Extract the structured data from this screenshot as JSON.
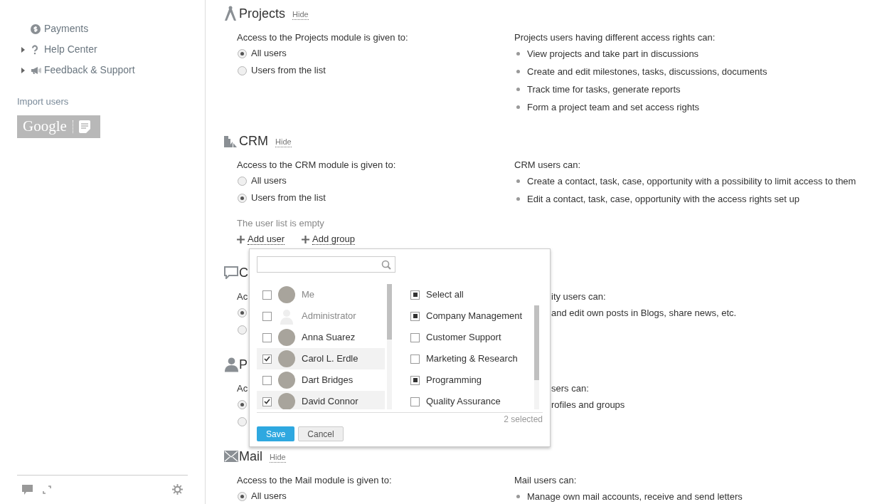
{
  "sidebar": {
    "items": [
      {
        "label": "Payments",
        "expandable": false
      },
      {
        "label": "Help Center",
        "expandable": true
      },
      {
        "label": "Feedback & Support",
        "expandable": true
      }
    ],
    "import_label": "Import users",
    "import_button": "Google"
  },
  "sections": [
    {
      "kind": "full",
      "title": "Projects",
      "hide": "Hide",
      "access_label": "Access to the Projects module is given to:",
      "options": [
        {
          "label": "All users",
          "selected": true
        },
        {
          "label": "Users from the list",
          "selected": false
        }
      ],
      "rights_title": "Projects users having different access rights can:",
      "rights": [
        "View projects and take part in discussions",
        "Create and edit milestones, tasks, discussions, documents",
        "Track time for tasks, generate reports",
        "Form a project team and set access rights"
      ]
    },
    {
      "kind": "full",
      "title": "CRM",
      "hide": "Hide",
      "access_label": "Access to the CRM module is given to:",
      "options": [
        {
          "label": "All users",
          "selected": false
        },
        {
          "label": "Users from the list",
          "selected": true
        }
      ],
      "rights_title": "CRM users can:",
      "rights": [
        "Create a contact, task, case, opportunity with a possibility to limit access to them",
        "Edit a contact, task, case, opportunity with the access rights set up"
      ],
      "user_list": {
        "empty": "The user list is empty",
        "add_user": "Add user",
        "add_group": "Add group"
      }
    },
    {
      "kind": "covered",
      "title": "C",
      "access_label": "Ac",
      "options": [
        {
          "selected": true
        },
        {
          "selected": false
        }
      ],
      "rights_title": "ity users can:",
      "rights": [
        "and edit own posts in Blogs, share news, etc."
      ]
    },
    {
      "kind": "covered",
      "title": "P",
      "access_label": "Ac",
      "options": [
        {
          "selected": true
        },
        {
          "selected": false
        }
      ],
      "rights_title": "sers can:",
      "rights": [
        "rofiles and groups"
      ]
    },
    {
      "kind": "full",
      "title": "Mail",
      "hide": "Hide",
      "access_label": "Access to the Mail module is given to:",
      "options": [
        {
          "label": "All users",
          "selected": true
        }
      ],
      "rights_title": "Mail users can:",
      "rights": [
        "Manage own mail accounts, receive and send letters"
      ]
    }
  ],
  "popup": {
    "users": [
      {
        "name": "Me",
        "checked": false,
        "muted": true
      },
      {
        "name": "Administrator",
        "checked": false,
        "muted": true
      },
      {
        "name": "Anna Suarez",
        "checked": false,
        "muted": false
      },
      {
        "name": "Carol L. Erdle",
        "checked": true,
        "muted": false
      },
      {
        "name": "Dart Bridges",
        "checked": false,
        "muted": false
      },
      {
        "name": "David Connor",
        "checked": true,
        "muted": false
      }
    ],
    "groups": [
      {
        "label": "Select all",
        "checked": true
      },
      {
        "label": "Company Management",
        "checked": true
      },
      {
        "label": "Customer Support",
        "checked": false
      },
      {
        "label": "Marketing & Research",
        "checked": false
      },
      {
        "label": "Programming",
        "checked": true
      },
      {
        "label": "Quality Assurance",
        "checked": false
      }
    ],
    "count": "2 selected",
    "save": "Save",
    "cancel": "Cancel"
  }
}
